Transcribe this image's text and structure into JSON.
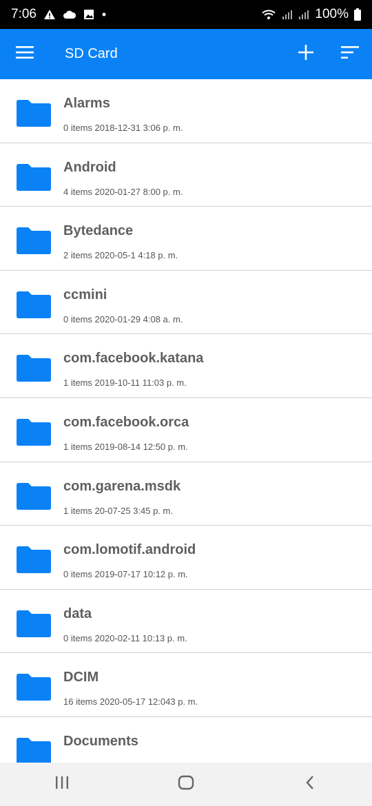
{
  "status": {
    "time": "7:06",
    "battery": "100%"
  },
  "header": {
    "title": "SD Card"
  },
  "files": [
    {
      "name": "Alarms",
      "meta": "0 items 2018-12-31 3:06 p. m."
    },
    {
      "name": "Android",
      "meta": "4 items 2020-01-27 8:00 p. m."
    },
    {
      "name": "Bytedance",
      "meta": "2 items 2020-05-1 4:18 p. m."
    },
    {
      "name": "ccmini",
      "meta": "0 items 2020-01-29 4:08 a. m."
    },
    {
      "name": "com.facebook.katana",
      "meta": "1 items 2019-10-11 11:03 p. m."
    },
    {
      "name": "com.facebook.orca",
      "meta": "1 items 2019-08-14 12:50 p. m."
    },
    {
      "name": "com.garena.msdk",
      "meta": "1 items 20-07-25 3:45 p. m."
    },
    {
      "name": "com.lomotif.android",
      "meta": "0 items 2019-07-17 10:12 p. m."
    },
    {
      "name": "data",
      "meta": "0 items 2020-02-11 10:13 p. m."
    },
    {
      "name": "DCIM",
      "meta": "16 items 2020-05-17 12:043 p. m."
    },
    {
      "name": "Documents",
      "meta": ""
    }
  ],
  "colors": {
    "accent": "#0a82f5",
    "folder": "#0a82f5"
  },
  "icons": {
    "menu": "hamburger-icon",
    "add": "plus-icon",
    "sort": "sort-icon",
    "folder": "folder-icon",
    "recent": "recent-apps-icon",
    "home": "home-icon",
    "back": "back-icon"
  }
}
